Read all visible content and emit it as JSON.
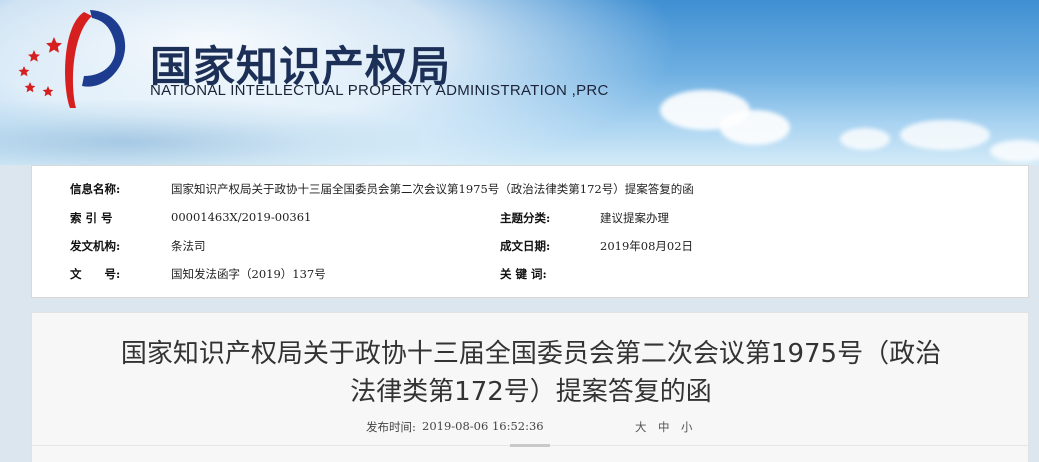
{
  "header": {
    "cn_title": "国家知识产权局",
    "en_title": "NATIONAL INTELLECTUAL PROPERTY ADMINISTRATION ,PRC",
    "colors": {
      "logo_blue": "#1d3c8f",
      "logo_red": "#d5201f"
    }
  },
  "info": {
    "name_label": "信息名称:",
    "name_value": "国家知识产权局关于政协十三届全国委员会第二次会议第1975号（政治法律类第172号）提案答复的函",
    "index_label": "索 引 号",
    "index_value": "00001463X/2019-00361",
    "category_label": "主题分类:",
    "category_value": "建议提案办理",
    "issuer_label": "发文机构:",
    "issuer_value": "条法司",
    "date_label": "成文日期:",
    "date_value": "2019年08月02日",
    "doc_label": "文　　号:",
    "doc_value": "国知发法函字（2019）137号",
    "keywords_label": "关 键 词:",
    "keywords_value": ""
  },
  "article": {
    "title_line1": "国家知识产权局关于政协十三届全国委员会第二次会议第1975号（政治",
    "title_line2": "法律类第172号）提案答复的函",
    "publish_label": "发布时间:",
    "publish_time": "2019-08-06 16:52:36",
    "font_sizes": [
      "大",
      "中",
      "小"
    ]
  }
}
